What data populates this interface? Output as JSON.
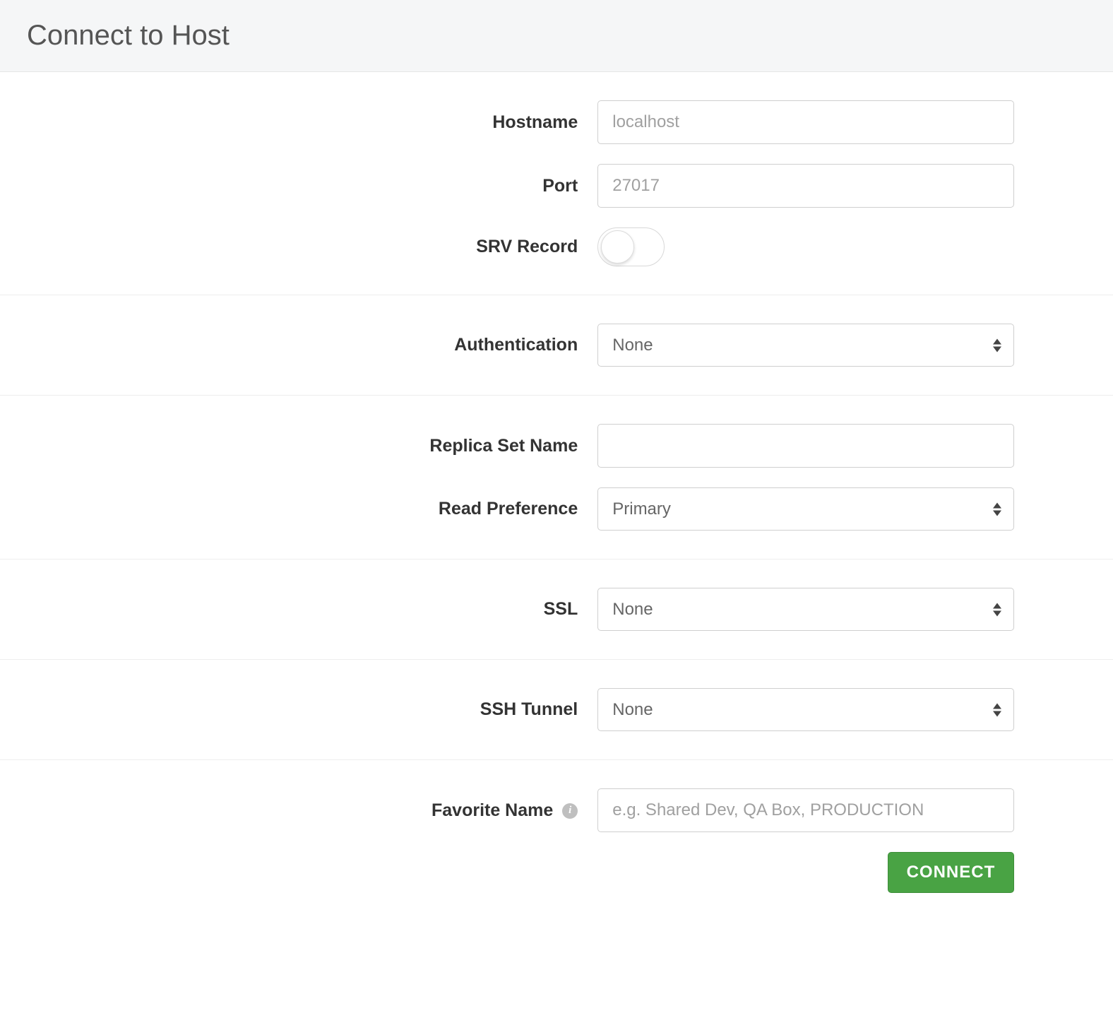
{
  "header": {
    "title": "Connect to Host"
  },
  "fields": {
    "hostname": {
      "label": "Hostname",
      "placeholder": "localhost",
      "value": ""
    },
    "port": {
      "label": "Port",
      "placeholder": "27017",
      "value": ""
    },
    "srv_record": {
      "label": "SRV Record",
      "on": false
    },
    "authentication": {
      "label": "Authentication",
      "value": "None"
    },
    "replica_set_name": {
      "label": "Replica Set Name",
      "placeholder": "",
      "value": ""
    },
    "read_preference": {
      "label": "Read Preference",
      "value": "Primary"
    },
    "ssl": {
      "label": "SSL",
      "value": "None"
    },
    "ssh_tunnel": {
      "label": "SSH Tunnel",
      "value": "None"
    },
    "favorite_name": {
      "label": "Favorite Name",
      "placeholder": "e.g. Shared Dev, QA Box, PRODUCTION",
      "value": ""
    }
  },
  "actions": {
    "connect_label": "CONNECT"
  }
}
